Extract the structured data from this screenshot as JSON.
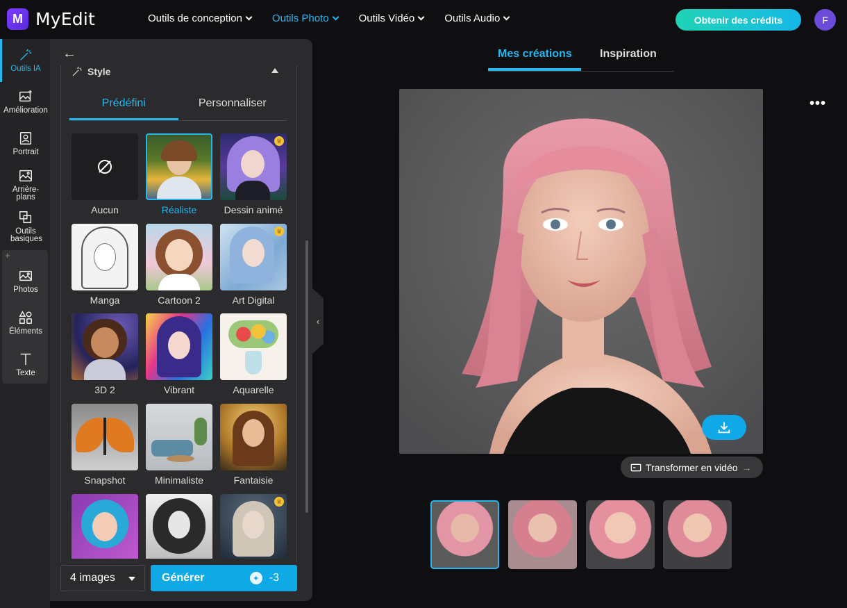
{
  "app": {
    "logo_letter": "M",
    "name": "MyEdit"
  },
  "nav": [
    {
      "label": "Outils de conception",
      "active": false
    },
    {
      "label": "Outils Photo",
      "active": true
    },
    {
      "label": "Outils Vidéo",
      "active": false
    },
    {
      "label": "Outils Audio",
      "active": false
    }
  ],
  "header": {
    "credits_button": "Obtenir des crédits",
    "avatar_letter": "F"
  },
  "rail": [
    {
      "label": "Outils IA",
      "icon": "magic-wand-icon",
      "active": true
    },
    {
      "label": "Amélioration",
      "icon": "image-enhance-icon"
    },
    {
      "label": "Portrait",
      "icon": "portrait-icon"
    },
    {
      "label": "Arrière-plans",
      "icon": "background-icon"
    },
    {
      "label": "Outils basiques",
      "icon": "crop-icon"
    },
    {
      "label": "Photos",
      "icon": "photo-icon"
    },
    {
      "label": "Éléments",
      "icon": "shapes-icon"
    },
    {
      "label": "Texte",
      "icon": "text-icon"
    }
  ],
  "panel": {
    "section_title": "Style",
    "tabs": [
      {
        "label": "Prédéfini",
        "active": true
      },
      {
        "label": "Personnaliser",
        "active": false
      }
    ],
    "styles": [
      {
        "label": "Aucun",
        "selected": false,
        "premium": false
      },
      {
        "label": "Réaliste",
        "selected": true,
        "premium": false
      },
      {
        "label": "Dessin animé",
        "selected": false,
        "premium": true
      },
      {
        "label": "Manga",
        "selected": false,
        "premium": false
      },
      {
        "label": "Cartoon 2",
        "selected": false,
        "premium": false
      },
      {
        "label": "Art Digital",
        "selected": false,
        "premium": true
      },
      {
        "label": "3D 2",
        "selected": false,
        "premium": false
      },
      {
        "label": "Vibrant",
        "selected": false,
        "premium": false
      },
      {
        "label": "Aquarelle",
        "selected": false,
        "premium": false
      },
      {
        "label": "Snapshot",
        "selected": false,
        "premium": false
      },
      {
        "label": "Minimaliste",
        "selected": false,
        "premium": false
      },
      {
        "label": "Fantaisie",
        "selected": false,
        "premium": false
      },
      {
        "label": "",
        "selected": false,
        "premium": false
      },
      {
        "label": "",
        "selected": false,
        "premium": false
      },
      {
        "label": "",
        "selected": false,
        "premium": true
      }
    ],
    "image_count": "4 images",
    "generate_label": "Générer",
    "generate_cost": "-3"
  },
  "content": {
    "tabs": [
      {
        "label": "Mes créations",
        "active": true
      },
      {
        "label": "Inspiration",
        "active": false
      }
    ],
    "more_label": "•••",
    "video_button": "Transformer en vidéo",
    "results": 4
  },
  "colors": {
    "accent": "#27b7ef",
    "bg": "#0f0f11",
    "panel": "#2b2b2e",
    "rail": "#242426"
  }
}
